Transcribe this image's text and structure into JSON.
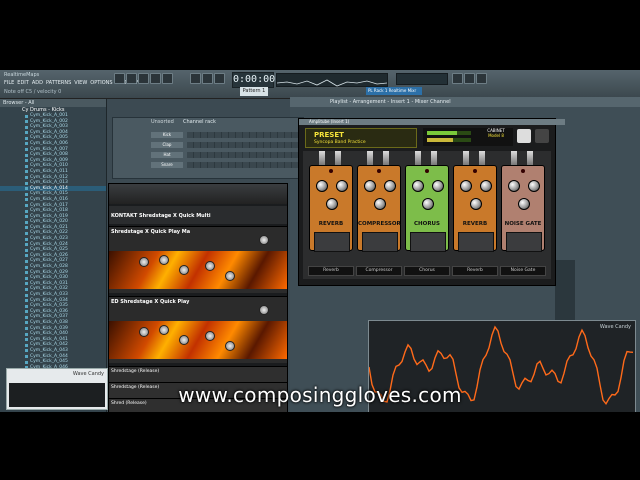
{
  "app": {
    "title": "RealtimeMaps",
    "hint": "Note off C5 / velocity 0",
    "time_display": "0:00:00",
    "pattern": "Pattern 1",
    "hint_panel": "PL Rack 1 Realtime Mixr"
  },
  "menu": [
    "FILE",
    "EDIT",
    "ADD",
    "PATTERNS",
    "VIEW",
    "OPTIONS",
    "TOOLS",
    "?"
  ],
  "browser": {
    "header": "Browser - All",
    "folder": "Cy Drums - Kicks",
    "selected_index": 13,
    "items": [
      "Cym_Kick_A_001",
      "Cym_Kick_A_002",
      "Cym_Kick_A_003",
      "Cym_Kick_A_004",
      "Cym_Kick_A_005",
      "Cym_Kick_A_006",
      "Cym_Kick_A_007",
      "Cym_Kick_A_008",
      "Cym_Kick_A_009",
      "Cym_Kick_A_010",
      "Cym_Kick_A_011",
      "Cym_Kick_A_012",
      "Cym_Kick_A_013",
      "Cym_Kick_A_014",
      "Cym_Kick_A_015",
      "Cym_Kick_A_016",
      "Cym_Kick_A_017",
      "Cym_Kick_A_018",
      "Cym_Kick_A_019",
      "Cym_Kick_A_020",
      "Cym_Kick_A_021",
      "Cym_Kick_A_022",
      "Cym_Kick_A_023",
      "Cym_Kick_A_024",
      "Cym_Kick_A_025",
      "Cym_Kick_A_026",
      "Cym_Kick_A_027",
      "Cym_Kick_A_028",
      "Cym_Kick_A_029",
      "Cym_Kick_A_030",
      "Cym_Kick_A_031",
      "Cym_Kick_A_032",
      "Cym_Kick_A_033",
      "Cym_Kick_A_034",
      "Cym_Kick_A_035",
      "Cym_Kick_A_036",
      "Cym_Kick_A_037",
      "Cym_Kick_A_038",
      "Cym_Kick_A_039",
      "Cym_Kick_A_040",
      "Cym_Kick_A_041",
      "Cym_Kick_A_042",
      "Cym_Kick_A_043",
      "Cym_Kick_A_044",
      "Cym_Kick_A_045",
      "Cym_Kick_A_046",
      "Cym_Kick_A_047",
      "Cym_Kick_A_048",
      "Cym_Kick_A_049",
      "Cym_Kick_A_050",
      "Cym_Kick_A_051"
    ]
  },
  "channel_rack": {
    "title": "Channel rack",
    "group": "Unsorted",
    "channels": [
      "Kick",
      "Clap",
      "Hat",
      "Snare"
    ]
  },
  "kontakt": {
    "title": "KONTAKT Shredstage X Quick Multi",
    "instruments": [
      {
        "name": "Shredstage X Quick Play Ma"
      },
      {
        "name": "ED Shredstage X Quick Play"
      }
    ],
    "small_slots": [
      "Shredstage (Release)",
      "Shredstage (Release)",
      "Shred (Release)"
    ]
  },
  "playlist": {
    "title": "Playlist - Arrangement - Insert 1 - Mixer Channel"
  },
  "amplitube": {
    "header": "Amplitube (Insert 1)",
    "preset_label": "PRESET",
    "preset_name": "Syncopa Band Practice",
    "cabinet_label": "CABINET",
    "cabinet_value": "Model 8",
    "pedals": [
      {
        "label": "REVERB",
        "color": "#c9792a",
        "name": "Reverb"
      },
      {
        "label": "COMPRESSOR",
        "color": "#c9792a",
        "name": "Compressor"
      },
      {
        "label": "CHORUS",
        "color": "#7dbd4a",
        "name": "Chorus"
      },
      {
        "label": "REVERB",
        "color": "#c9792a",
        "name": "Reverb"
      },
      {
        "label": "NOISE GATE",
        "color": "#b08070",
        "name": "Noise Gate"
      }
    ]
  },
  "wave_candy": {
    "left_label": "Wave Candy",
    "right_label": "Wave Candy",
    "wave_color": "#ff6a1a"
  },
  "watermark": "www.composinggloves.com"
}
